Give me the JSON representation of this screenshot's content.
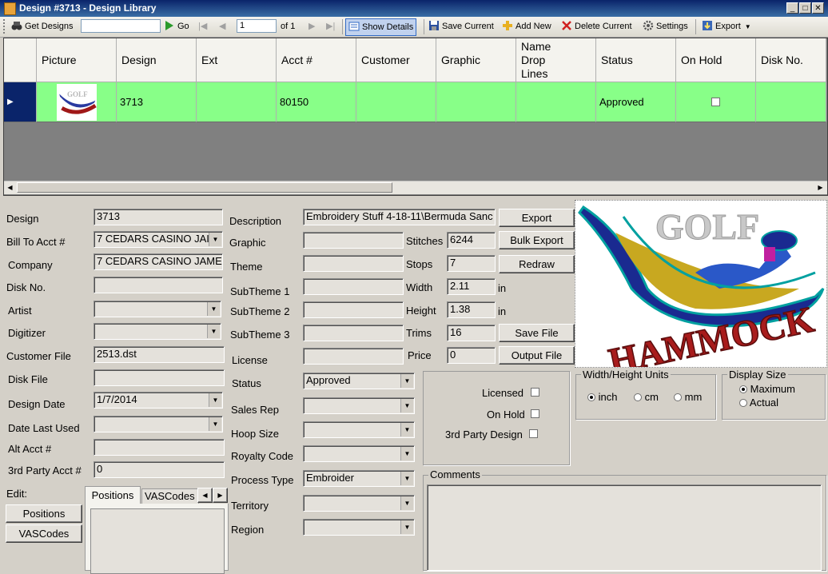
{
  "window": {
    "title": "Design #3713 - Design Library"
  },
  "toolbar": {
    "get_designs": "Get Designs",
    "search_value": "",
    "go": "Go",
    "page_value": "1",
    "page_of": "of 1",
    "show_details": "Show Details",
    "save_current": "Save Current",
    "add_new": "Add New",
    "delete_current": "Delete Current",
    "settings": "Settings",
    "export": "Export"
  },
  "grid": {
    "columns": [
      "Picture",
      "Design",
      "Ext",
      "Acct #",
      "Customer",
      "Graphic",
      "Name Drop Lines",
      "Status",
      "On Hold",
      "Disk No."
    ],
    "rows": [
      {
        "design": "3713",
        "ext": "",
        "acct": "80150",
        "customer": "",
        "graphic": "",
        "name_drop": "",
        "status": "Approved",
        "on_hold": false,
        "disk": ""
      }
    ]
  },
  "form": {
    "design_label": "Design",
    "design": "3713",
    "bill_to_label": "Bill To Acct #",
    "bill_to": "7 CEDARS CASINO JAI",
    "company_label": "Company",
    "company": "7 CEDARS CASINO JAME",
    "disk_no_label": "Disk No.",
    "disk_no": "",
    "artist_label": "Artist",
    "artist": "",
    "digitizer_label": "Digitizer",
    "digitizer": "",
    "customer_file_label": "Customer File",
    "customer_file": "2513.dst",
    "disk_file_label": "Disk File",
    "disk_file": "",
    "design_date_label": "Design Date",
    "design_date": "1/7/2014",
    "date_last_used_label": "Date Last Used",
    "date_last_used": "",
    "alt_acct_label": "Alt Acct #",
    "alt_acct": "",
    "third_party_acct_label": "3rd Party Acct #",
    "third_party_acct": "0",
    "edit_label": "Edit:",
    "positions_btn": "Positions",
    "vascodes_btn": "VASCodes",
    "tab_positions": "Positions",
    "tab_vascodes": "VASCodes",
    "description_label": "Description",
    "description": "Embroidery Stuff 4-18-11\\Bermuda Sanc",
    "graphic_label": "Graphic",
    "graphic": "",
    "theme_label": "Theme",
    "theme": "",
    "subtheme1_label": "SubTheme 1",
    "subtheme1": "",
    "subtheme2_label": "SubTheme 2",
    "subtheme2": "",
    "subtheme3_label": "SubTheme 3",
    "subtheme3": "",
    "license_label": "License",
    "license": "",
    "status_label": "Status",
    "status": "Approved",
    "sales_rep_label": "Sales Rep",
    "sales_rep": "",
    "hoop_size_label": "Hoop Size",
    "hoop_size": "",
    "royalty_label": "Royalty Code",
    "royalty": "",
    "process_type_label": "Process Type",
    "process_type": "Embroider",
    "territory_label": "Territory",
    "territory": "",
    "region_label": "Region",
    "region": "",
    "stitches_label": "Stitches",
    "stitches": "6244",
    "stops_label": "Stops",
    "stops": "7",
    "width_label": "Width",
    "width": "2.11",
    "width_unit": "in",
    "height_label": "Height",
    "height": "1.38",
    "height_unit": "in",
    "trims_label": "Trims",
    "trims": "16",
    "price_label": "Price",
    "price": "0",
    "export_btn": "Export",
    "bulk_export_btn": "Bulk Export",
    "redraw_btn": "Redraw",
    "save_file_btn": "Save File",
    "output_file_btn": "Output File",
    "licensed_label": "Licensed",
    "on_hold_label": "On Hold",
    "third_party_design_label": "3rd Party Design",
    "units_title": "Width/Height Units",
    "unit_inch": "inch",
    "unit_cm": "cm",
    "unit_mm": "mm",
    "display_title": "Display Size",
    "display_max": "Maximum",
    "display_actual": "Actual",
    "comments_title": "Comments",
    "comments": ""
  },
  "preview": {
    "top_text": "GOLF",
    "bottom_text": "HAMMOCK"
  },
  "colors": {
    "row_highlight": "#88ff88",
    "title_bar": "#0a246a"
  }
}
